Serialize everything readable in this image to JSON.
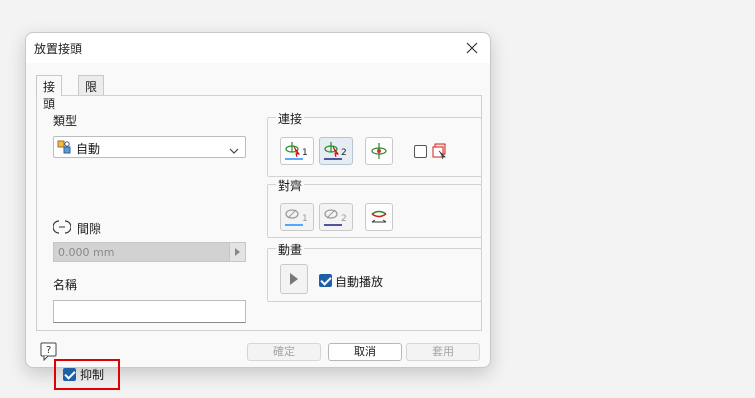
{
  "dialog": {
    "title": "放置接頭",
    "tabs": [
      "接頭",
      "限制"
    ],
    "type_label": "類型",
    "type_value": "自動",
    "gap_label": "間隙",
    "gap_value": "0.000 mm",
    "name_label": "名稱",
    "name_value": "",
    "suppress_label": "抑制",
    "suppress_checked": true,
    "connect_title": "連接",
    "connect_btn1": "1",
    "connect_btn2": "2",
    "align_title": "對齊",
    "align_btn1": "1",
    "align_btn2": "2",
    "animate_title": "動畫",
    "autoplay_label": "自動播放",
    "autoplay_checked": true,
    "ok_label": "確定",
    "cancel_label": "取消",
    "apply_label": "套用"
  }
}
